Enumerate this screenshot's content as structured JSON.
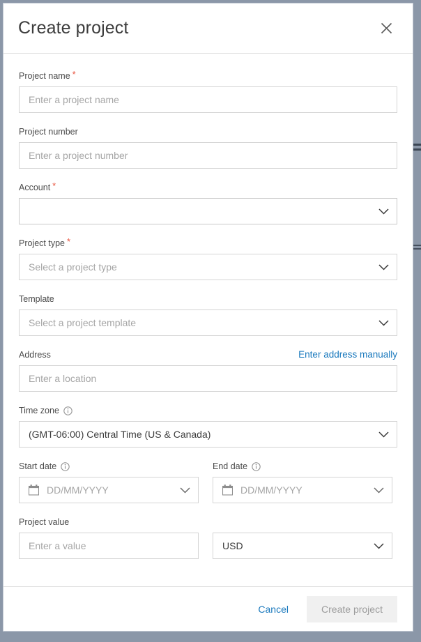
{
  "modal": {
    "title": "Create project",
    "close_icon": "close-icon"
  },
  "fields": {
    "project_name": {
      "label": "Project name",
      "required": "*",
      "placeholder": "Enter a project name",
      "value": ""
    },
    "project_number": {
      "label": "Project number",
      "placeholder": "Enter a project number",
      "value": ""
    },
    "account": {
      "label": "Account",
      "required": "*",
      "value": ""
    },
    "project_type": {
      "label": "Project type",
      "required": "*",
      "placeholder": "Select a project type",
      "value": ""
    },
    "template": {
      "label": "Template",
      "placeholder": "Select a project template",
      "value": ""
    },
    "address": {
      "label": "Address",
      "manual_link": "Enter address manually",
      "placeholder": "Enter a location",
      "value": ""
    },
    "time_zone": {
      "label": "Time zone",
      "info_icon": "info-icon",
      "value": "(GMT-06:00) Central Time (US & Canada)"
    },
    "start_date": {
      "label": "Start date",
      "info_icon": "info-icon",
      "calendar_icon": "calendar-icon",
      "placeholder": "DD/MM/YYYY",
      "value": ""
    },
    "end_date": {
      "label": "End date",
      "info_icon": "info-icon",
      "calendar_icon": "calendar-icon",
      "placeholder": "DD/MM/YYYY",
      "value": ""
    },
    "project_value": {
      "label": "Project value",
      "placeholder": "Enter a value",
      "value": ""
    },
    "currency": {
      "value": "USD"
    }
  },
  "footer": {
    "cancel_label": "Cancel",
    "submit_label": "Create project"
  },
  "colors": {
    "link_blue": "#1a79bd",
    "required_red": "#e8543f",
    "backdrop": "#8b97a8",
    "disabled_button_bg": "#f0f0f0",
    "disabled_button_text": "#9b9b9b"
  }
}
